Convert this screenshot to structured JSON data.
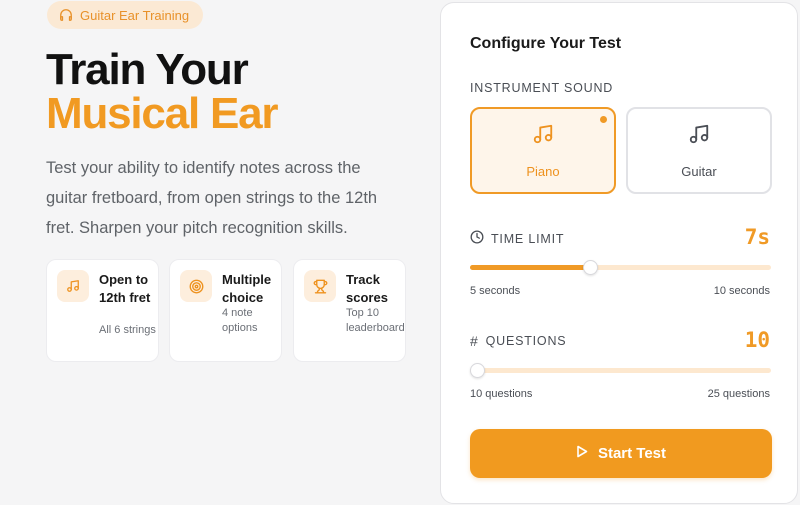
{
  "badge": {
    "label": "Guitar Ear Training",
    "icon": "headphones-icon"
  },
  "hero": {
    "title_line1": "Train Your",
    "title_line2": "Musical Ear",
    "description": "Test your ability to identify notes across the guitar fretboard, from open strings to the 12th fret. Sharpen your pitch recognition skills."
  },
  "features": [
    {
      "icon": "music-note-icon",
      "title": "Open to 12th fret",
      "subtitle": "All 6 strings"
    },
    {
      "icon": "target-icon",
      "title": "Multiple choice",
      "subtitle": "4 note options"
    },
    {
      "icon": "trophy-icon",
      "title": "Track scores",
      "subtitle": "Top 10 leaderboard"
    }
  ],
  "config": {
    "title": "Configure Your Test",
    "instrument": {
      "label": "INSTRUMENT SOUND",
      "options": [
        {
          "name": "Piano",
          "selected": true
        },
        {
          "name": "Guitar",
          "selected": false
        }
      ]
    },
    "time_limit": {
      "label": "TIME LIMIT",
      "value_display": "7s",
      "value": 7,
      "min": 5,
      "max": 10,
      "min_label": "5 seconds",
      "max_label": "10 seconds"
    },
    "questions": {
      "label": "QUESTIONS",
      "value_display": "10",
      "value": 10,
      "min": 10,
      "max": 25,
      "min_label": "10 questions",
      "max_label": "25 questions"
    },
    "start_label": "Start Test"
  },
  "colors": {
    "accent": "#f09a26",
    "accent_soft": "#fdeedd",
    "text_muted": "#5f6368"
  }
}
